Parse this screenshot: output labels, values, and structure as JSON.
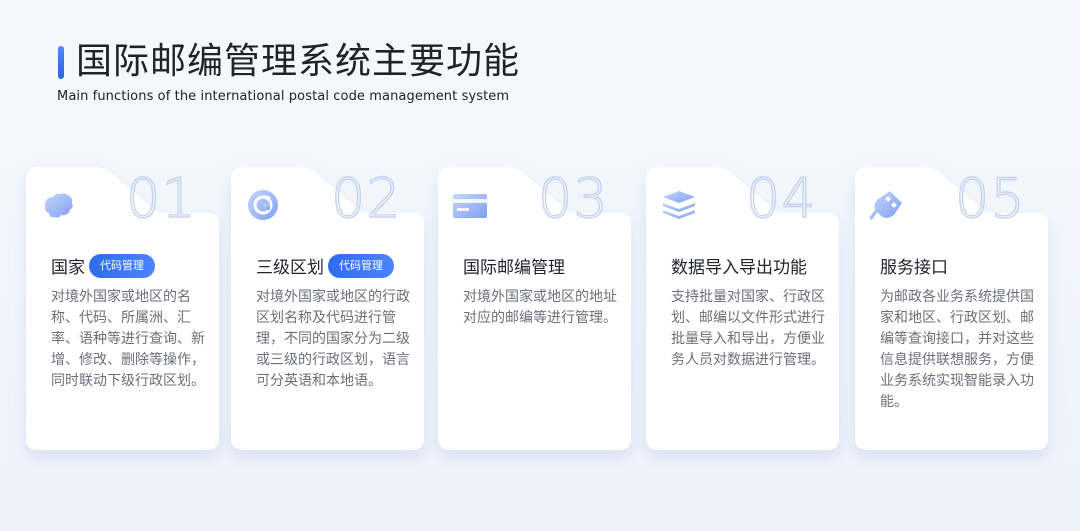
{
  "header": {
    "title": "国际邮编管理系统主要功能",
    "subtitle": "Main functions of the international postal code management system"
  },
  "colors": {
    "accent": "#2f6bf0",
    "number_outline": "#c6d3ef",
    "desc_text": "#6b6f78"
  },
  "cards": [
    {
      "number": "01",
      "icon": "globe-map-icon",
      "title": "国家",
      "badge": "代码管理",
      "description": "对境外国家或地区的名称、代码、所属洲、汇率、语种等进行查询、新增、修改、删除等操作，同时联动下级行政区划。"
    },
    {
      "number": "02",
      "icon": "refresh-cycle-icon",
      "title": "三级区划",
      "badge": "代码管理",
      "description": "对境外国家或地区的行政区划名称及代码进行管理，不同的国家分为二级或三级的行政区划，语言可分英语和本地语。"
    },
    {
      "number": "03",
      "icon": "envelope-card-icon",
      "title": "国际邮编管理",
      "badge": "",
      "description": "对境外国家或地区的地址对应的邮编等进行管理。"
    },
    {
      "number": "04",
      "icon": "database-stack-icon",
      "title": "数据导入导出功能",
      "badge": "",
      "description": "支持批量对国家、行政区划、邮编以文件形式进行批量导入和导出，方便业务人员对数据进行管理。"
    },
    {
      "number": "05",
      "icon": "api-plug-icon",
      "title": "服务接口",
      "badge": "",
      "description": "为邮政各业务系统提供国家和地区、行政区划、邮编等查询接口，并对这些信息提供联想服务，方便业务系统实现智能录入功能。"
    }
  ]
}
